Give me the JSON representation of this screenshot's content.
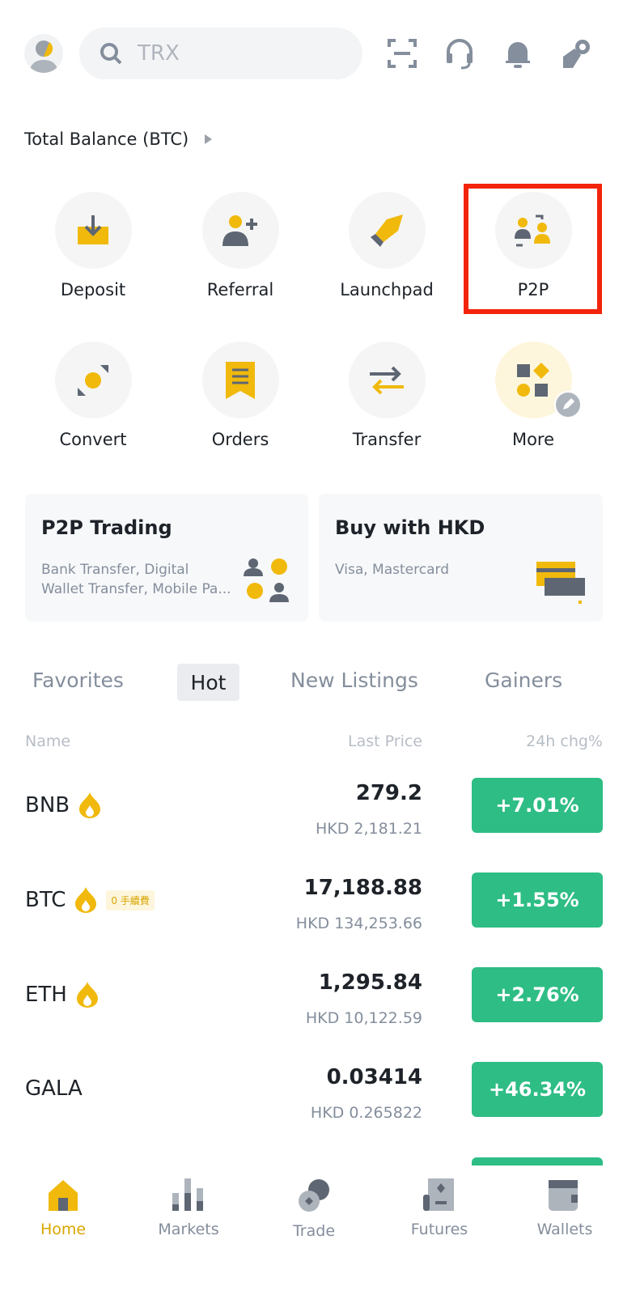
{
  "header": {
    "search_placeholder": "TRX",
    "icons": [
      "avatar",
      "search-icon",
      "scan-icon",
      "headset-icon",
      "bell-icon",
      "gift-icon"
    ]
  },
  "balance": {
    "label": "Total Balance (BTC)"
  },
  "quick_actions": [
    {
      "label": "Deposit",
      "icon": "deposit-icon"
    },
    {
      "label": "Referral",
      "icon": "referral-icon"
    },
    {
      "label": "Launchpad",
      "icon": "rocket-icon"
    },
    {
      "label": "P2P",
      "icon": "p2p-icon",
      "highlighted": true
    },
    {
      "label": "Convert",
      "icon": "convert-icon"
    },
    {
      "label": "Orders",
      "icon": "orders-icon"
    },
    {
      "label": "Transfer",
      "icon": "transfer-icon"
    },
    {
      "label": "More",
      "icon": "more-icon"
    }
  ],
  "cards": [
    {
      "title": "P2P Trading",
      "sub1": "Bank Transfer, Digital",
      "sub2": "Wallet Transfer, Mobile Pa..."
    },
    {
      "title": "Buy with HKD",
      "sub1": "Visa, Mastercard"
    }
  ],
  "tabs": {
    "items": [
      "Favorites",
      "Hot",
      "New Listings",
      "Gainers"
    ],
    "active": "Hot"
  },
  "columns": {
    "name": "Name",
    "price": "Last Price",
    "change": "24h chg%"
  },
  "rows": [
    {
      "symbol": "BNB",
      "price": "279.2",
      "hkd": "HKD 2,181.21",
      "change": "+7.01%"
    },
    {
      "symbol": "BTC",
      "badge": "0 手續費",
      "price": "17,188.88",
      "hkd": "HKD 134,253.66",
      "change": "+1.55%"
    },
    {
      "symbol": "ETH",
      "price": "1,295.84",
      "hkd": "HKD 10,122.59",
      "change": "+2.76%"
    },
    {
      "symbol": "GALA",
      "price": "0.03414",
      "hkd": "HKD 0.265822",
      "change": "+46.34%"
    }
  ],
  "nav": {
    "items": [
      "Home",
      "Markets",
      "Trade",
      "Futures",
      "Wallets"
    ],
    "active": "Home"
  },
  "colors": {
    "accent": "#f0b90b",
    "up": "#2ebd85",
    "highlight": "#f3240b"
  }
}
